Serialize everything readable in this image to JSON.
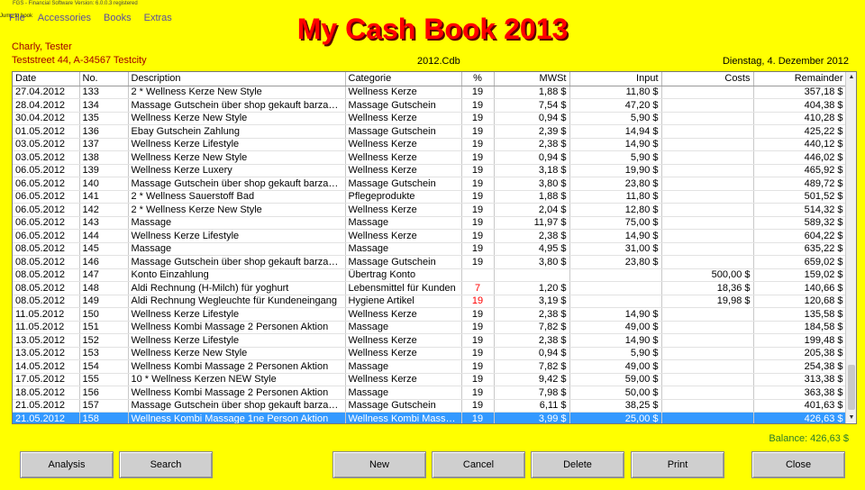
{
  "window": {
    "title": "FGS - Financial Software  Version: 6.0.0.3  registered",
    "jump_label": "Jump to book"
  },
  "menu": {
    "items": [
      "File",
      "Accessories",
      "Books",
      "Extras"
    ]
  },
  "header": {
    "title": "My Cash Book 2013",
    "owner_name": "Charly, Tester",
    "owner_address": "Teststreet 44, A-34567 Testcity",
    "book_file": "2012.Cdb",
    "date": "Dienstag, 4. Dezember 2012"
  },
  "colors": {
    "background": "#ffff00",
    "title": "#ff0000",
    "info_text": "#a00000",
    "selection": "#3399ff",
    "balance_text": "#2a7a2a"
  },
  "table": {
    "columns": [
      "Date",
      "No.",
      "Description",
      "Categorie",
      "%",
      "MWSt",
      "Input",
      "Costs",
      "Remainder"
    ],
    "rows": [
      [
        "27.04.2012",
        "133",
        "2 * Wellness Kerze New Style",
        "Wellness Kerze",
        "19",
        "1,88 $",
        "11,80 $",
        "",
        "357,18 $"
      ],
      [
        "28.04.2012",
        "134",
        "Massage Gutschein über shop gekauft barzahl...",
        "Massage Gutschein",
        "19",
        "7,54 $",
        "47,20 $",
        "",
        "404,38 $"
      ],
      [
        "30.04.2012",
        "135",
        "Wellness Kerze New Style",
        "Wellness Kerze",
        "19",
        "0,94 $",
        "5,90 $",
        "",
        "410,28 $"
      ],
      [
        "01.05.2012",
        "136",
        "Ebay Gutschein Zahlung",
        "Massage Gutschein",
        "19",
        "2,39 $",
        "14,94 $",
        "",
        "425,22 $"
      ],
      [
        "03.05.2012",
        "137",
        "Wellness Kerze Lifestyle",
        "Wellness Kerze",
        "19",
        "2,38 $",
        "14,90 $",
        "",
        "440,12 $"
      ],
      [
        "03.05.2012",
        "138",
        "Wellness Kerze New Style",
        "Wellness Kerze",
        "19",
        "0,94 $",
        "5,90 $",
        "",
        "446,02 $"
      ],
      [
        "06.05.2012",
        "139",
        "Wellness Kerze Luxery",
        "Wellness Kerze",
        "19",
        "3,18 $",
        "19,90 $",
        "",
        "465,92 $"
      ],
      [
        "06.05.2012",
        "140",
        "Massage Gutschein über shop gekauft barzahl...",
        "Massage Gutschein",
        "19",
        "3,80 $",
        "23,80 $",
        "",
        "489,72 $"
      ],
      [
        "06.05.2012",
        "141",
        "2 * Wellness Sauerstoff Bad",
        "Pflegeprodukte",
        "19",
        "1,88 $",
        "11,80 $",
        "",
        "501,52 $"
      ],
      [
        "06.05.2012",
        "142",
        "2 * Wellness Kerze New Style",
        "Wellness Kerze",
        "19",
        "2,04 $",
        "12,80 $",
        "",
        "514,32 $"
      ],
      [
        "06.05.2012",
        "143",
        "Massage",
        "Massage",
        "19",
        "11,97 $",
        "75,00 $",
        "",
        "589,32 $"
      ],
      [
        "06.05.2012",
        "144",
        "Wellness Kerze Lifestyle",
        "Wellness Kerze",
        "19",
        "2,38 $",
        "14,90 $",
        "",
        "604,22 $"
      ],
      [
        "08.05.2012",
        "145",
        "Massage",
        "Massage",
        "19",
        "4,95 $",
        "31,00 $",
        "",
        "635,22 $"
      ],
      [
        "08.05.2012",
        "146",
        "Massage Gutschein über shop gekauft barzahl...",
        "Massage Gutschein",
        "19",
        "3,80 $",
        "23,80 $",
        "",
        "659,02 $"
      ],
      [
        "08.05.2012",
        "147",
        "Konto Einzahlung",
        "Übertrag Konto",
        "",
        "",
        "",
        "500,00 $",
        "159,02 $"
      ],
      [
        "08.05.2012",
        "148",
        "Aldi Rechnung (H-Milch) für yoghurt",
        "Lebensmittel für Kunden",
        "7",
        "1,20 $",
        "",
        "18,36 $",
        "140,66 $"
      ],
      [
        "08.05.2012",
        "149",
        "Aldi Rechnung  Wegleuchte für Kundeneingang",
        "Hygiene Artikel",
        "19",
        "3,19 $",
        "",
        "19,98 $",
        "120,68 $"
      ],
      [
        "11.05.2012",
        "150",
        "Wellness Kerze Lifestyle",
        "Wellness Kerze",
        "19",
        "2,38 $",
        "14,90 $",
        "",
        "135,58 $"
      ],
      [
        "11.05.2012",
        "151",
        "Wellness Kombi Massage 2 Personen Aktion",
        "Massage",
        "19",
        "7,82 $",
        "49,00 $",
        "",
        "184,58 $"
      ],
      [
        "13.05.2012",
        "152",
        "Wellness Kerze Lifestyle",
        "Wellness Kerze",
        "19",
        "2,38 $",
        "14,90 $",
        "",
        "199,48 $"
      ],
      [
        "13.05.2012",
        "153",
        "Wellness Kerze New Style",
        "Wellness Kerze",
        "19",
        "0,94 $",
        "5,90 $",
        "",
        "205,38 $"
      ],
      [
        "14.05.2012",
        "154",
        "Wellness Kombi Massage 2 Personen Aktion",
        "Massage",
        "19",
        "7,82 $",
        "49,00 $",
        "",
        "254,38 $"
      ],
      [
        "17.05.2012",
        "155",
        "10 * Wellness Kerzen NEW Style",
        "Wellness Kerze",
        "19",
        "9,42 $",
        "59,00 $",
        "",
        "313,38 $"
      ],
      [
        "18.05.2012",
        "156",
        "Wellness Kombi Massage 2 Personen Aktion",
        "Massage",
        "19",
        "7,98 $",
        "50,00 $",
        "",
        "363,38 $"
      ],
      [
        "21.05.2012",
        "157",
        "Massage Gutschein über shop gekauft barzahl...",
        "Massage Gutschein",
        "19",
        "6,11 $",
        "38,25 $",
        "",
        "401,63 $"
      ],
      [
        "21.05.2012",
        "158",
        "Wellness Kombi Massage 1ne Person  Aktion",
        "Wellness Kombi Massa...",
        "19",
        "3,99 $",
        "25,00 $",
        "",
        "426,63 $"
      ]
    ],
    "selected_index": 25,
    "red_percent_rows": [
      15,
      16
    ]
  },
  "footer": {
    "balance": "Balance: 426,63 $",
    "buttons": {
      "analysis": "Analysis",
      "search": "Search",
      "new": "New",
      "cancel": "Cancel",
      "delete": "Delete",
      "print": "Print",
      "close": "Close"
    }
  }
}
